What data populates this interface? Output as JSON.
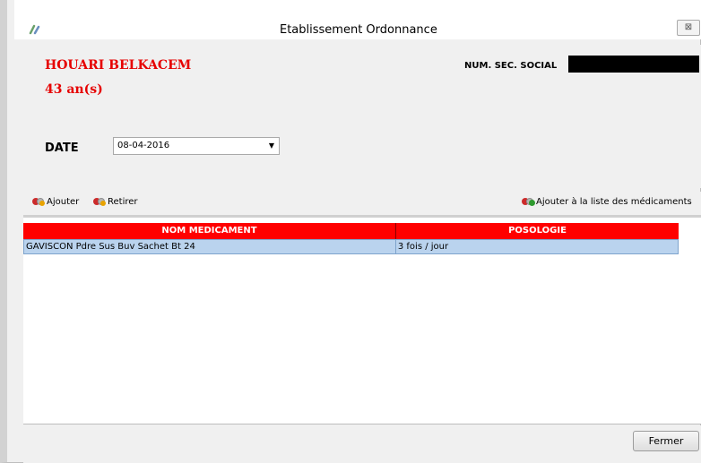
{
  "window": {
    "title": "Etablissement Ordonnance",
    "close_glyph": "⊠"
  },
  "patient": {
    "name": "HOUARI BELKACEM",
    "age": "43 an(s)",
    "nss_label": "NUM. SEC. SOCIAL",
    "nss_value_redacted": true
  },
  "date": {
    "label": "DATE",
    "value": "08-04-2016"
  },
  "toolbar": {
    "add_label": "Ajouter",
    "remove_label": "Retirer",
    "add_to_list_label": "Ajouter à la liste des médicaments"
  },
  "grid": {
    "columns": [
      "NOM MEDICAMENT",
      "POSOLOGIE"
    ],
    "rows": [
      {
        "nom": "GAVISCON Pdre Sus Buv Sachet Bt 24",
        "posologie": "3 fois / jour"
      }
    ]
  },
  "footer": {
    "close_label": "Fermer"
  },
  "colors": {
    "accent_red": "#ff0000",
    "patient_text": "#e60000",
    "row_selected": "#bad3ee"
  },
  "icons": {
    "app": "pill-app-icon",
    "add": "add-medication-icon",
    "remove": "remove-medication-icon",
    "add_to_list": "add-to-list-icon",
    "close": "close-icon",
    "dropdown": "chevron-down-icon"
  }
}
